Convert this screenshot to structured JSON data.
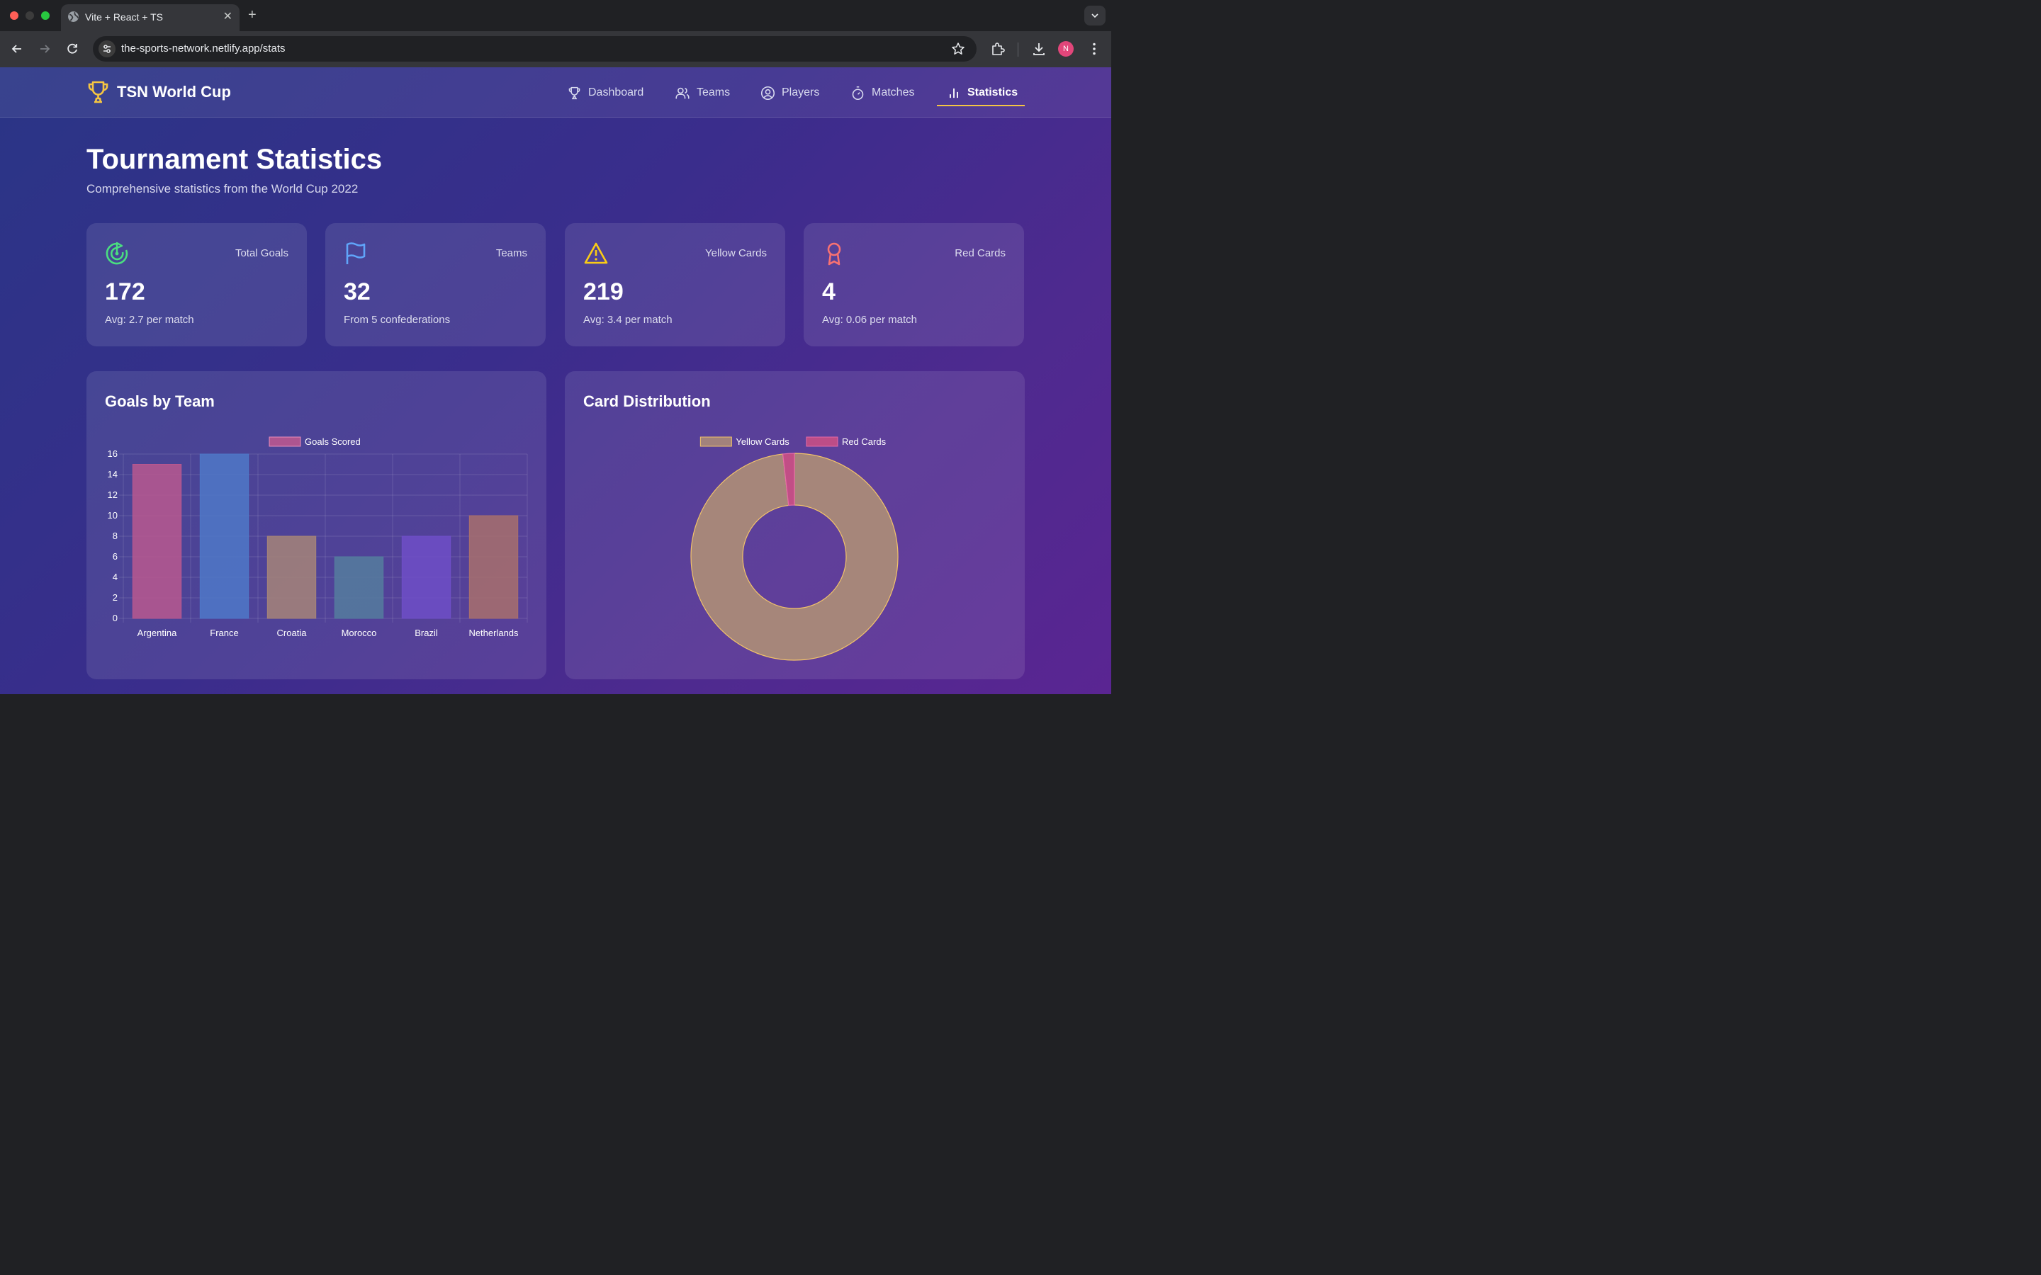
{
  "browser": {
    "tab_title": "Vite + React + TS",
    "new_tab_label": "+",
    "url": "the-sports-network.netlify.app/stats",
    "profile_initial": "N"
  },
  "app": {
    "brand": "TSN World Cup",
    "nav": [
      {
        "label": "Dashboard",
        "icon": "trophy-icon",
        "active": false
      },
      {
        "label": "Teams",
        "icon": "users-icon",
        "active": false
      },
      {
        "label": "Players",
        "icon": "user-circle-icon",
        "active": false
      },
      {
        "label": "Matches",
        "icon": "timer-icon",
        "active": false
      },
      {
        "label": "Statistics",
        "icon": "bar-chart-icon",
        "active": true
      }
    ],
    "accent_color": "#f5c542"
  },
  "page": {
    "title": "Tournament Statistics",
    "subtitle": "Comprehensive statistics from the World Cup 2022"
  },
  "stats": [
    {
      "label": "Total Goals",
      "value": "172",
      "sub": "Avg: 2.7 per match",
      "icon": "goal-target-icon",
      "color": "#4ade80"
    },
    {
      "label": "Teams",
      "value": "32",
      "sub": "From 5 confederations",
      "icon": "flag-icon",
      "color": "#60a5fa"
    },
    {
      "label": "Yellow Cards",
      "value": "219",
      "sub": "Avg: 3.4 per match",
      "icon": "warning-icon",
      "color": "#facc15"
    },
    {
      "label": "Red Cards",
      "value": "4",
      "sub": "Avg: 0.06 per match",
      "icon": "award-ribbon-icon",
      "color": "#f87171"
    }
  ],
  "panels": {
    "goals_title": "Goals by Team",
    "cards_title": "Card Distribution"
  },
  "chart_data": [
    {
      "type": "bar",
      "title": "Goals by Team",
      "categories": [
        "Argentina",
        "France",
        "Croatia",
        "Morocco",
        "Brazil",
        "Netherlands"
      ],
      "series": [
        {
          "name": "Goals Scored",
          "values": [
            15,
            16,
            8,
            6,
            8,
            10
          ]
        }
      ],
      "colors": [
        "#b9588f",
        "#4f78c8",
        "#a68478",
        "#557d9e",
        "#6f4fc7",
        "#a8706c"
      ],
      "ylim": [
        0,
        16
      ],
      "yticks": [
        0,
        2,
        4,
        6,
        8,
        10,
        12,
        14,
        16
      ],
      "grid": true,
      "legend": "top"
    },
    {
      "type": "pie",
      "style": "doughnut",
      "title": "Card Distribution",
      "labels": [
        "Yellow Cards",
        "Red Cards"
      ],
      "values": [
        219,
        4
      ],
      "colors": [
        "#a6867a",
        "#c24e86"
      ],
      "legend": "top"
    }
  ]
}
